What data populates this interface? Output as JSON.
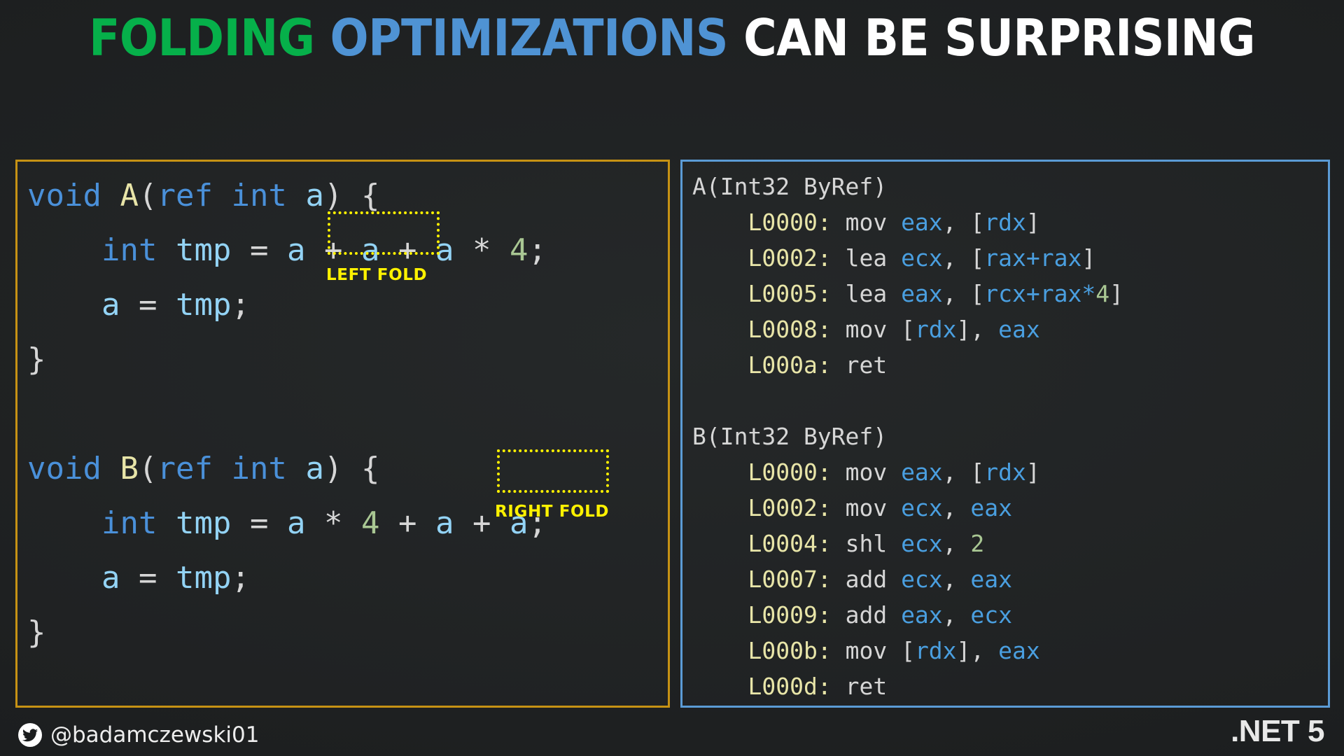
{
  "slide": {
    "background_color": "#1e2021",
    "title": {
      "segments": [
        {
          "text": "FOLDING",
          "color": "#06B04A"
        },
        {
          "text": " ",
          "color": "#FFFFFF"
        },
        {
          "text": "OPTIMIZATIONS",
          "color": "#4F93D4"
        },
        {
          "text": " CAN BE SURPRISING",
          "color": "#FFFFFF"
        }
      ],
      "plain": "FOLDING OPTIMIZATIONS CAN BE SURPRISING"
    }
  },
  "code_panel": {
    "border_color": "#C69214",
    "language": "csharp",
    "lines": [
      [
        {
          "t": "void",
          "c": "kw"
        },
        {
          "t": " ",
          "c": "punc"
        },
        {
          "t": "A",
          "c": "fn"
        },
        {
          "t": "(",
          "c": "punc"
        },
        {
          "t": "ref",
          "c": "kw"
        },
        {
          "t": " ",
          "c": "punc"
        },
        {
          "t": "int",
          "c": "kw"
        },
        {
          "t": " ",
          "c": "punc"
        },
        {
          "t": "a",
          "c": "var"
        },
        {
          "t": ")",
          "c": "punc"
        },
        {
          "t": " ",
          "c": "punc"
        },
        {
          "t": "{",
          "c": "punc"
        }
      ],
      [
        {
          "t": "    ",
          "c": "punc"
        },
        {
          "t": "int",
          "c": "kw"
        },
        {
          "t": " ",
          "c": "punc"
        },
        {
          "t": "tmp",
          "c": "var"
        },
        {
          "t": " ",
          "c": "punc"
        },
        {
          "t": "=",
          "c": "punc"
        },
        {
          "t": " ",
          "c": "punc"
        },
        {
          "t": "a",
          "c": "var"
        },
        {
          "t": " ",
          "c": "punc"
        },
        {
          "t": "+",
          "c": "punc"
        },
        {
          "t": " ",
          "c": "punc"
        },
        {
          "t": "a",
          "c": "var"
        },
        {
          "t": " ",
          "c": "punc"
        },
        {
          "t": "+",
          "c": "punc"
        },
        {
          "t": " ",
          "c": "punc"
        },
        {
          "t": "a",
          "c": "var"
        },
        {
          "t": " ",
          "c": "punc"
        },
        {
          "t": "*",
          "c": "punc"
        },
        {
          "t": " ",
          "c": "punc"
        },
        {
          "t": "4",
          "c": "num"
        },
        {
          "t": ";",
          "c": "punc"
        }
      ],
      [
        {
          "t": "    ",
          "c": "punc"
        },
        {
          "t": "a",
          "c": "var"
        },
        {
          "t": " ",
          "c": "punc"
        },
        {
          "t": "=",
          "c": "punc"
        },
        {
          "t": " ",
          "c": "punc"
        },
        {
          "t": "tmp",
          "c": "var"
        },
        {
          "t": ";",
          "c": "punc"
        }
      ],
      [
        {
          "t": "}",
          "c": "punc"
        }
      ],
      [
        {
          "t": "",
          "c": "punc"
        }
      ],
      [
        {
          "t": "void",
          "c": "kw"
        },
        {
          "t": " ",
          "c": "punc"
        },
        {
          "t": "B",
          "c": "fn"
        },
        {
          "t": "(",
          "c": "punc"
        },
        {
          "t": "ref",
          "c": "kw"
        },
        {
          "t": " ",
          "c": "punc"
        },
        {
          "t": "int",
          "c": "kw"
        },
        {
          "t": " ",
          "c": "punc"
        },
        {
          "t": "a",
          "c": "var"
        },
        {
          "t": ")",
          "c": "punc"
        },
        {
          "t": " ",
          "c": "punc"
        },
        {
          "t": "{",
          "c": "punc"
        }
      ],
      [
        {
          "t": "    ",
          "c": "punc"
        },
        {
          "t": "int",
          "c": "kw"
        },
        {
          "t": " ",
          "c": "punc"
        },
        {
          "t": "tmp",
          "c": "var"
        },
        {
          "t": " ",
          "c": "punc"
        },
        {
          "t": "=",
          "c": "punc"
        },
        {
          "t": " ",
          "c": "punc"
        },
        {
          "t": "a",
          "c": "var"
        },
        {
          "t": " ",
          "c": "punc"
        },
        {
          "t": "*",
          "c": "punc"
        },
        {
          "t": " ",
          "c": "punc"
        },
        {
          "t": "4",
          "c": "num"
        },
        {
          "t": " ",
          "c": "punc"
        },
        {
          "t": "+",
          "c": "punc"
        },
        {
          "t": " ",
          "c": "punc"
        },
        {
          "t": "a",
          "c": "var"
        },
        {
          "t": " ",
          "c": "punc"
        },
        {
          "t": "+",
          "c": "punc"
        },
        {
          "t": " ",
          "c": "punc"
        },
        {
          "t": "a",
          "c": "var"
        },
        {
          "t": ";",
          "c": "punc"
        }
      ],
      [
        {
          "t": "    ",
          "c": "punc"
        },
        {
          "t": "a",
          "c": "var"
        },
        {
          "t": " ",
          "c": "punc"
        },
        {
          "t": "=",
          "c": "punc"
        },
        {
          "t": " ",
          "c": "punc"
        },
        {
          "t": "tmp",
          "c": "var"
        },
        {
          "t": ";",
          "c": "punc"
        }
      ],
      [
        {
          "t": "}",
          "c": "punc"
        }
      ]
    ],
    "plain_text": "void A(ref int a) {\n    int tmp = a + a + a * 4;\n    a = tmp;\n}\n\nvoid B(ref int a) {\n    int tmp = a * 4 + a + a;\n    a = tmp;\n}"
  },
  "annotations": {
    "highlight_color": "#FFF200",
    "left_fold": {
      "label": "LEFT FOLD",
      "expression": "a + a"
    },
    "right_fold": {
      "label": "RIGHT FOLD",
      "expression": "a + a"
    }
  },
  "asm_panel": {
    "border_color": "#5B9BD5",
    "lines": [
      [
        {
          "t": "A(Int32 ByRef)",
          "c": "sig"
        }
      ],
      [
        {
          "t": "    ",
          "c": "mn"
        },
        {
          "t": "L0000:",
          "c": "lbl"
        },
        {
          "t": " ",
          "c": "mn"
        },
        {
          "t": "mov",
          "c": "mn"
        },
        {
          "t": " ",
          "c": "mn"
        },
        {
          "t": "eax",
          "c": "reg"
        },
        {
          "t": ", ",
          "c": "mn"
        },
        {
          "t": "[",
          "c": "mn"
        },
        {
          "t": "rdx",
          "c": "reg"
        },
        {
          "t": "]",
          "c": "mn"
        }
      ],
      [
        {
          "t": "    ",
          "c": "mn"
        },
        {
          "t": "L0002:",
          "c": "lbl"
        },
        {
          "t": " ",
          "c": "mn"
        },
        {
          "t": "lea",
          "c": "mn"
        },
        {
          "t": " ",
          "c": "mn"
        },
        {
          "t": "ecx",
          "c": "reg"
        },
        {
          "t": ", ",
          "c": "mn"
        },
        {
          "t": "[",
          "c": "mn"
        },
        {
          "t": "rax+rax",
          "c": "reg"
        },
        {
          "t": "]",
          "c": "mn"
        }
      ],
      [
        {
          "t": "    ",
          "c": "mn"
        },
        {
          "t": "L0005:",
          "c": "lbl"
        },
        {
          "t": " ",
          "c": "mn"
        },
        {
          "t": "lea",
          "c": "mn"
        },
        {
          "t": " ",
          "c": "mn"
        },
        {
          "t": "eax",
          "c": "reg"
        },
        {
          "t": ", ",
          "c": "mn"
        },
        {
          "t": "[",
          "c": "mn"
        },
        {
          "t": "rcx+rax",
          "c": "reg"
        },
        {
          "t": "*",
          "c": "reg"
        },
        {
          "t": "4",
          "c": "num"
        },
        {
          "t": "]",
          "c": "mn"
        }
      ],
      [
        {
          "t": "    ",
          "c": "mn"
        },
        {
          "t": "L0008:",
          "c": "lbl"
        },
        {
          "t": " ",
          "c": "mn"
        },
        {
          "t": "mov",
          "c": "mn"
        },
        {
          "t": " ",
          "c": "mn"
        },
        {
          "t": "[",
          "c": "mn"
        },
        {
          "t": "rdx",
          "c": "reg"
        },
        {
          "t": "], ",
          "c": "mn"
        },
        {
          "t": "eax",
          "c": "reg"
        }
      ],
      [
        {
          "t": "    ",
          "c": "mn"
        },
        {
          "t": "L000a:",
          "c": "lbl"
        },
        {
          "t": " ",
          "c": "mn"
        },
        {
          "t": "ret",
          "c": "mn"
        }
      ],
      [
        {
          "t": "",
          "c": "mn"
        }
      ],
      [
        {
          "t": "B(Int32 ByRef)",
          "c": "sig"
        }
      ],
      [
        {
          "t": "    ",
          "c": "mn"
        },
        {
          "t": "L0000:",
          "c": "lbl"
        },
        {
          "t": " ",
          "c": "mn"
        },
        {
          "t": "mov",
          "c": "mn"
        },
        {
          "t": " ",
          "c": "mn"
        },
        {
          "t": "eax",
          "c": "reg"
        },
        {
          "t": ", ",
          "c": "mn"
        },
        {
          "t": "[",
          "c": "mn"
        },
        {
          "t": "rdx",
          "c": "reg"
        },
        {
          "t": "]",
          "c": "mn"
        }
      ],
      [
        {
          "t": "    ",
          "c": "mn"
        },
        {
          "t": "L0002:",
          "c": "lbl"
        },
        {
          "t": " ",
          "c": "mn"
        },
        {
          "t": "mov",
          "c": "mn"
        },
        {
          "t": " ",
          "c": "mn"
        },
        {
          "t": "ecx",
          "c": "reg"
        },
        {
          "t": ", ",
          "c": "mn"
        },
        {
          "t": "eax",
          "c": "reg"
        }
      ],
      [
        {
          "t": "    ",
          "c": "mn"
        },
        {
          "t": "L0004:",
          "c": "lbl"
        },
        {
          "t": " ",
          "c": "mn"
        },
        {
          "t": "shl",
          "c": "mn"
        },
        {
          "t": " ",
          "c": "mn"
        },
        {
          "t": "ecx",
          "c": "reg"
        },
        {
          "t": ", ",
          "c": "mn"
        },
        {
          "t": "2",
          "c": "num"
        }
      ],
      [
        {
          "t": "    ",
          "c": "mn"
        },
        {
          "t": "L0007:",
          "c": "lbl"
        },
        {
          "t": " ",
          "c": "mn"
        },
        {
          "t": "add",
          "c": "mn"
        },
        {
          "t": " ",
          "c": "mn"
        },
        {
          "t": "ecx",
          "c": "reg"
        },
        {
          "t": ", ",
          "c": "mn"
        },
        {
          "t": "eax",
          "c": "reg"
        }
      ],
      [
        {
          "t": "    ",
          "c": "mn"
        },
        {
          "t": "L0009:",
          "c": "lbl"
        },
        {
          "t": " ",
          "c": "mn"
        },
        {
          "t": "add",
          "c": "mn"
        },
        {
          "t": " ",
          "c": "mn"
        },
        {
          "t": "eax",
          "c": "reg"
        },
        {
          "t": ", ",
          "c": "mn"
        },
        {
          "t": "ecx",
          "c": "reg"
        }
      ],
      [
        {
          "t": "    ",
          "c": "mn"
        },
        {
          "t": "L000b:",
          "c": "lbl"
        },
        {
          "t": " ",
          "c": "mn"
        },
        {
          "t": "mov",
          "c": "mn"
        },
        {
          "t": " ",
          "c": "mn"
        },
        {
          "t": "[",
          "c": "mn"
        },
        {
          "t": "rdx",
          "c": "reg"
        },
        {
          "t": "], ",
          "c": "mn"
        },
        {
          "t": "eax",
          "c": "reg"
        }
      ],
      [
        {
          "t": "    ",
          "c": "mn"
        },
        {
          "t": "L000d:",
          "c": "lbl"
        },
        {
          "t": " ",
          "c": "mn"
        },
        {
          "t": "ret",
          "c": "mn"
        }
      ]
    ],
    "plain_text": "A(Int32 ByRef)\n    L0000: mov eax, [rdx]\n    L0002: lea ecx, [rax+rax]\n    L0005: lea eax, [rcx+rax*4]\n    L0008: mov [rdx], eax\n    L000a: ret\n\nB(Int32 ByRef)\n    L0000: mov eax, [rdx]\n    L0002: mov ecx, eax\n    L0004: shl ecx, 2\n    L0007: add ecx, eax\n    L0009: add eax, ecx\n    L000b: mov [rdx], eax\n    L000d: ret"
  },
  "footer": {
    "twitter_handle": "@badamczewski01",
    "twitter_icon": "twitter-bird-icon",
    "version": ".NET 5"
  }
}
